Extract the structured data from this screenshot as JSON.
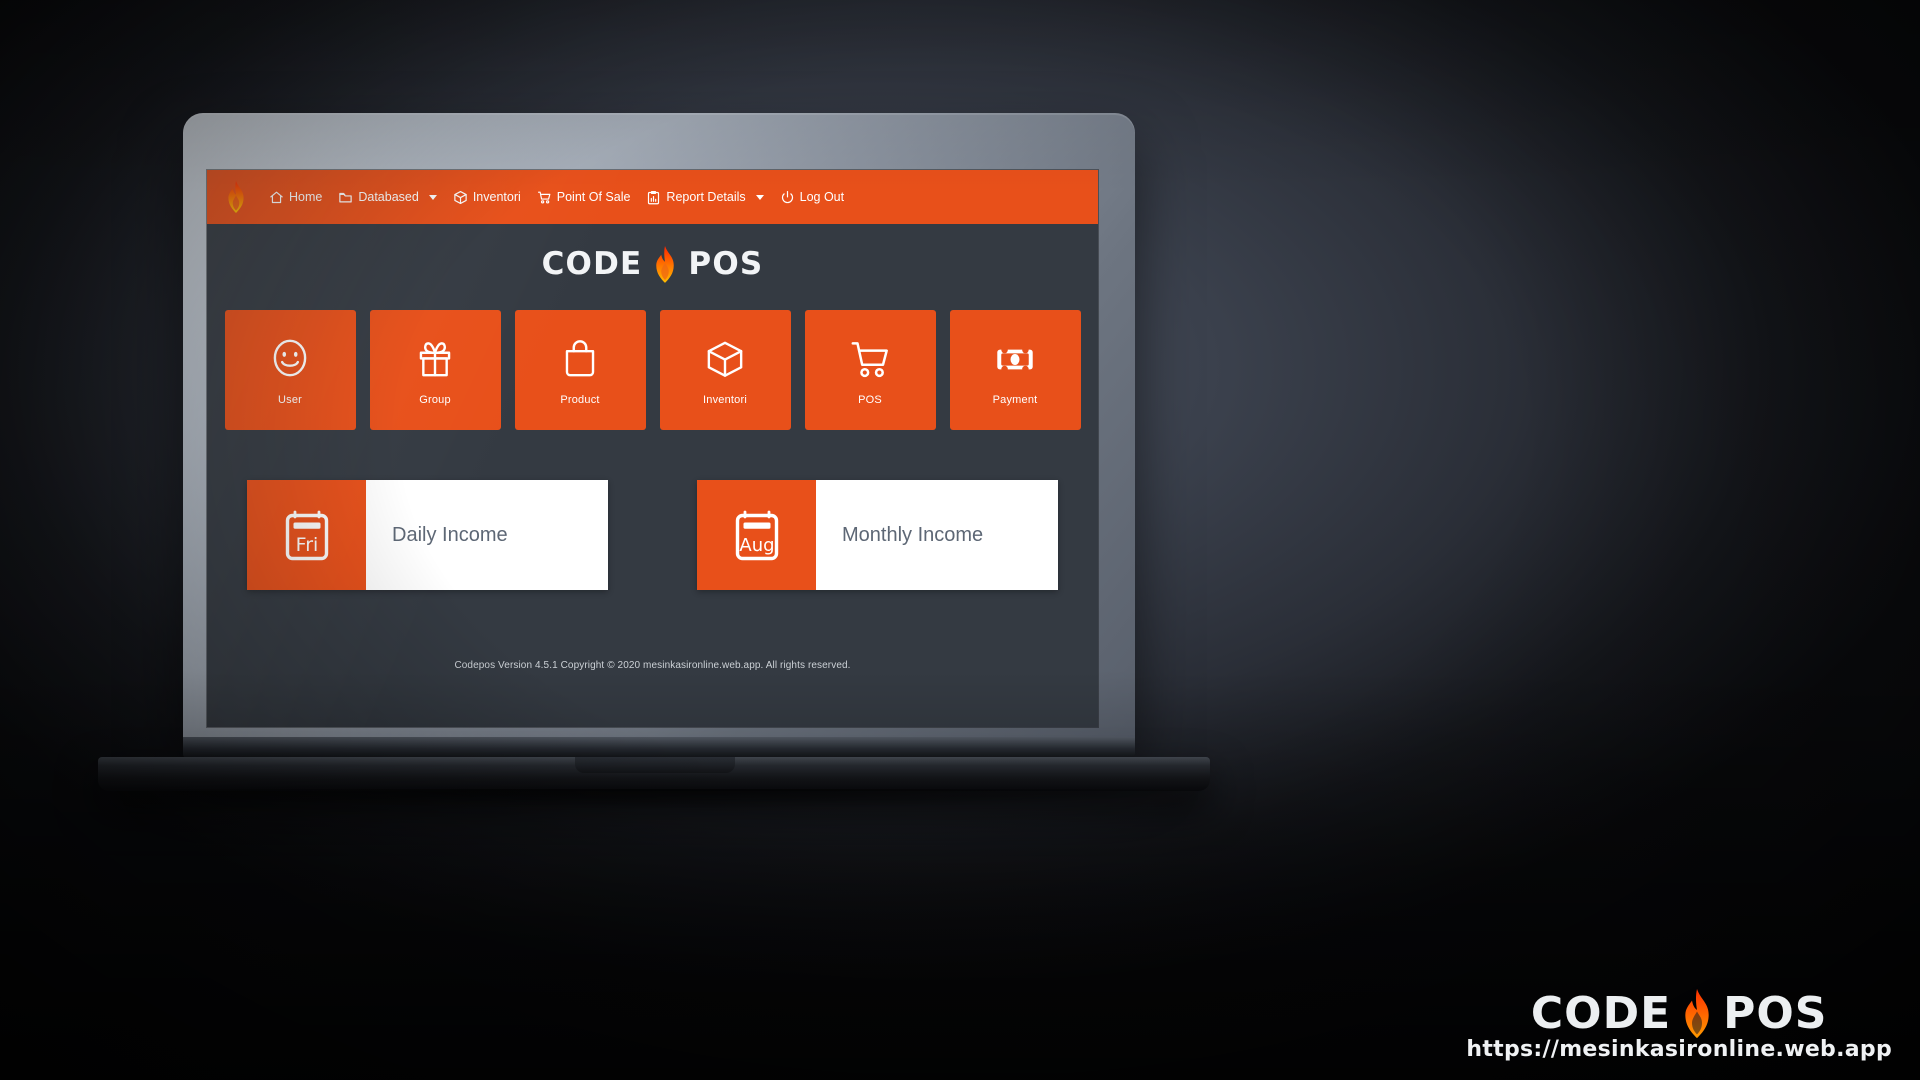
{
  "navbar": {
    "brand_icon": "flame-icon",
    "items": [
      {
        "label": "Home",
        "icon": "home-icon",
        "has_caret": false
      },
      {
        "label": "Databased",
        "icon": "folder-icon",
        "has_caret": true
      },
      {
        "label": "Inventori",
        "icon": "cube-icon",
        "has_caret": false
      },
      {
        "label": "Point Of Sale",
        "icon": "shopping-cart-icon",
        "has_caret": false
      },
      {
        "label": "Report Details",
        "icon": "clipboard-chart-icon",
        "has_caret": true
      },
      {
        "label": "Log Out",
        "icon": "power-icon",
        "has_caret": false
      }
    ]
  },
  "logo": {
    "left": "CODE",
    "right": "POS",
    "icon": "flame-icon"
  },
  "tiles": [
    {
      "label": "User",
      "icon": "smiley-face-icon"
    },
    {
      "label": "Group",
      "icon": "gift-box-icon"
    },
    {
      "label": "Product",
      "icon": "shopping-bag-icon"
    },
    {
      "label": "Inventori",
      "icon": "cube-3d-icon"
    },
    {
      "label": "POS",
      "icon": "shopping-cart-icon"
    },
    {
      "label": "Payment",
      "icon": "banknote-icon"
    }
  ],
  "income_cards": [
    {
      "title": "Daily Income",
      "badge": "Fri",
      "icon": "calendar-icon"
    },
    {
      "title": "Monthly Income",
      "badge": "Aug",
      "icon": "calendar-icon"
    }
  ],
  "footer": {
    "text": "Codepos Version 4.5.1 Copyright © 2020 mesinkasironline.web.app. All rights reserved."
  },
  "watermark": {
    "left": "CODE",
    "right": "POS",
    "url": "https://mesinkasironline.web.app",
    "icon": "flame-icon"
  },
  "colors": {
    "accent": "#e8501a",
    "app_background": "#343a42",
    "card_background": "#ffffff",
    "card_title": "#5d6775",
    "footer_text": "#ccd1d6"
  }
}
